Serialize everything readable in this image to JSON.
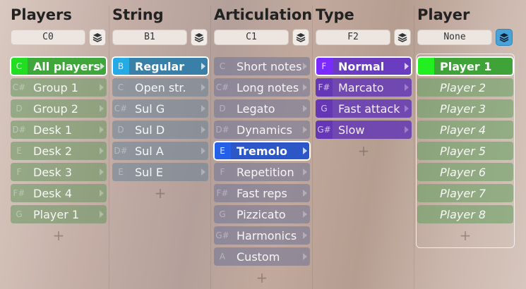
{
  "columns": [
    {
      "title": "Players",
      "key": "C0",
      "stack_active": false,
      "items": [
        {
          "note": "C",
          "label": "All players",
          "selected": true
        },
        {
          "note": "C#",
          "label": "Group 1"
        },
        {
          "note": "D",
          "label": "Group 2"
        },
        {
          "note": "D#",
          "label": "Desk 1"
        },
        {
          "note": "E",
          "label": "Desk 2"
        },
        {
          "note": "F",
          "label": "Desk 3"
        },
        {
          "note": "F#",
          "label": "Desk 4"
        },
        {
          "note": "G",
          "label": "Player 1"
        }
      ],
      "add": "+"
    },
    {
      "title": "String",
      "key": "B1",
      "stack_active": false,
      "items": [
        {
          "note": "B",
          "label": "Regular",
          "selected": true
        },
        {
          "note": "C",
          "label": "Open str."
        },
        {
          "note": "C#",
          "label": "Sul G"
        },
        {
          "note": "D",
          "label": "Sul D"
        },
        {
          "note": "D#",
          "label": "Sul A"
        },
        {
          "note": "E",
          "label": "Sul E"
        }
      ],
      "add": "+"
    },
    {
      "title": "Articulation",
      "key": "C1",
      "stack_active": false,
      "items": [
        {
          "note": "C",
          "label": "Short notes"
        },
        {
          "note": "C#",
          "label": "Long notes"
        },
        {
          "note": "D",
          "label": "Legato"
        },
        {
          "note": "D#",
          "label": "Dynamics"
        },
        {
          "note": "E",
          "label": "Tremolo",
          "selected": true
        },
        {
          "note": "F",
          "label": "Repetition"
        },
        {
          "note": "F#",
          "label": "Fast reps"
        },
        {
          "note": "G",
          "label": "Pizzicato"
        },
        {
          "note": "G#",
          "label": "Harmonics"
        },
        {
          "note": "A",
          "label": "Custom"
        }
      ],
      "add": "+"
    },
    {
      "title": "Type",
      "key": "F2",
      "stack_active": false,
      "items": [
        {
          "note": "F",
          "label": "Normal",
          "selected": true
        },
        {
          "note": "F#",
          "label": "Marcato"
        },
        {
          "note": "G",
          "label": "Fast attack"
        },
        {
          "note": "G#",
          "label": "Slow"
        }
      ],
      "add": "+"
    },
    {
      "title": "Player",
      "key": "None",
      "stack_active": true,
      "items": [
        {
          "note": "",
          "label": "Player 1",
          "selected": true
        },
        {
          "note": "",
          "label": "Player 2"
        },
        {
          "note": "",
          "label": "Player 3"
        },
        {
          "note": "",
          "label": "Player 4"
        },
        {
          "note": "",
          "label": "Player 5"
        },
        {
          "note": "",
          "label": "Player 6"
        },
        {
          "note": "",
          "label": "Player 7"
        },
        {
          "note": "",
          "label": "Player 8"
        }
      ],
      "add": "+"
    }
  ]
}
